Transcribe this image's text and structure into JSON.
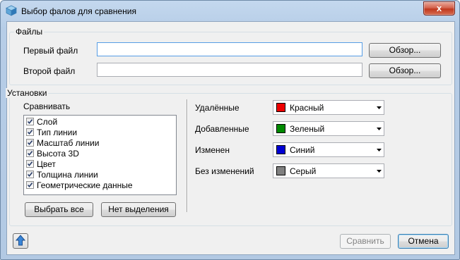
{
  "window": {
    "title": "Выбор фалов для сравнения",
    "close_label": "x"
  },
  "files": {
    "group_label": "Файлы",
    "first_label": "Первый файл",
    "first_value": "",
    "second_label": "Второй файл",
    "second_value": "",
    "browse_label": "Обзор..."
  },
  "settings": {
    "group_label": "Установки",
    "compare_label": "Сравнивать",
    "items": [
      {
        "label": "Слой",
        "checked": true
      },
      {
        "label": "Тип линии",
        "checked": true
      },
      {
        "label": "Масштаб линии",
        "checked": true
      },
      {
        "label": "Высота 3D",
        "checked": true
      },
      {
        "label": "Цвет",
        "checked": true
      },
      {
        "label": "Толщина линии",
        "checked": true
      },
      {
        "label": "Геометрические данные",
        "checked": true
      }
    ],
    "select_all_label": "Выбрать все",
    "select_none_label": "Нет выделения",
    "colors": [
      {
        "label": "Удалённые",
        "value": "Красный",
        "swatch": "#ee0000"
      },
      {
        "label": "Добавленные",
        "value": "Зеленый",
        "swatch": "#008a00"
      },
      {
        "label": "Изменен",
        "value": "Синий",
        "swatch": "#0000d4"
      },
      {
        "label": "Без изменений",
        "value": "Серый",
        "swatch": "#808080"
      }
    ]
  },
  "footer": {
    "compare_label": "Сравнить",
    "cancel_label": "Отмена"
  }
}
